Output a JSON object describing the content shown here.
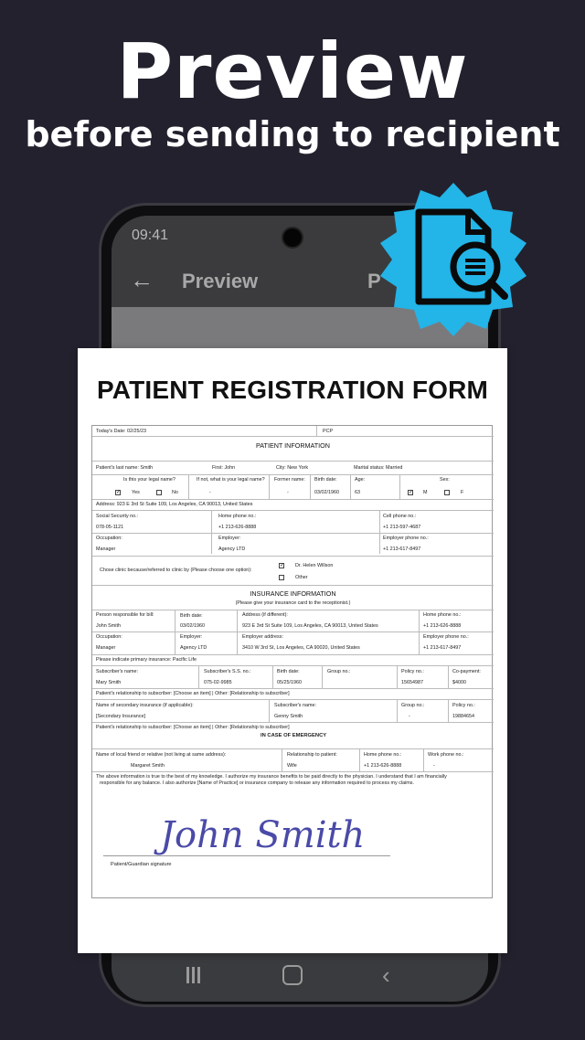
{
  "hero": {
    "title": "Preview",
    "subtitle": "before sending to recipient"
  },
  "status": {
    "time": "09:41"
  },
  "appbar": {
    "back": "←",
    "title": "Preview",
    "action": "P"
  },
  "nav": {
    "back": "‹"
  },
  "form": {
    "title": "PATIENT REGISTRATION FORM",
    "today": "Today's Date: 02/25/23",
    "pcp": "PCP",
    "patient_info": "PATIENT INFORMATION",
    "last_name": "Patient's last name: Smith",
    "first": "First: John",
    "city": "City: New York",
    "marital": "Marital status: Married",
    "legal_name_q": "Is this your legal name?",
    "legal_name_if": "If not, what is your legal name?",
    "former_name": "Former name:",
    "birth_date_lbl": "Birth date:",
    "age_lbl": "Age:",
    "sex_lbl": "Sex:",
    "yes": "Yes",
    "no": "No",
    "dash": "-",
    "birth_date": "03/02/1960",
    "age": "63",
    "m": "M",
    "f": "F",
    "address": "Address: 923 E 3rd St Suite 109, Los Angeles, CA 90013, United States",
    "ssn_lbl": "Social Security no.:",
    "ssn": "078-05-1121",
    "home_phone_lbl": "Home phone no.:",
    "home_phone": "+1 213-626-8888",
    "cell_lbl": "Cell phone no.:",
    "cell": "+1 213-597-4687",
    "occupation_lbl": "Occupation:",
    "occupation": "Manager",
    "employer_lbl": "Employer:",
    "employer": "Agency LTD",
    "emp_phone_lbl": "Employer phone no.:",
    "emp_phone": "+1 213-617-8497",
    "chose_clinic": "Chose clinic because/referred to clinic by (Please choose one option):",
    "dr": "Dr. Helen Willson",
    "other": "Other",
    "ins_info": "INSURANCE INFORMATION",
    "ins_note": "(Please give your insurance card to the receptionist.)",
    "person_bill_lbl": "Person responsible for bill:",
    "person_bill": "John Smith",
    "bd2_lbl": "Birth date:",
    "bd2": "03/02/1960",
    "addr_diff_lbl": "Address (if different):",
    "addr_diff": "923 E 3rd St Suite 109, Los Angeles, CA 90013, United States",
    "home2_lbl": "Home phone no.:",
    "home2": "+1 213-626-8888",
    "occ2_lbl": "Occupation:",
    "occ2": "Manager",
    "emp2_lbl": "Employer:",
    "emp2": "Agency LTD",
    "emp_addr_lbl": "Employer address:",
    "emp_addr": "3410 W 3rd St, Los Angeles, CA 90020, United States",
    "emp_phone2_lbl": "Employer phone no.:",
    "emp_phone2": "+1 213-617-8497",
    "primary_ins": "Please indicate primary insurance: Pacific Life",
    "sub_name_lbl": "Subscriber's name:",
    "sub_name": "Mary Smith",
    "sub_ss_lbl": "Subscriber's S.S. no.:",
    "sub_ss": "075-02-9985",
    "sub_bd_lbl": "Birth date:",
    "sub_bd": "05/25/1960",
    "group_lbl": "Group no.:",
    "policy_lbl": "Policy no.:",
    "policy": "15654987",
    "copay_lbl": "Co-payment:",
    "copay": "$4000",
    "rel1": "Patient's relationship to subscriber: [Choose an item] | Other: [Relationship to subscriber]",
    "sec_ins_lbl": "Name of secondary insurance (if applicable):",
    "sec_ins": "[Secondary Insurance]",
    "sub2_lbl": "Subscriber's name:",
    "sub2": "Genny Smith",
    "group2_lbl": "Group no.:",
    "group2": "-",
    "policy2_lbl": "Policy no.:",
    "policy2": "19884654",
    "rel2": "Patient's relationship to subscriber: [Choose an item] | Other: [Relationship to subscriber]",
    "emergency": "IN CASE OF EMERGENCY",
    "friend_lbl": "Name of local friend or relative (not living at same address):",
    "friend": "Margaret Smith",
    "rel_pat_lbl": "Relationship to patient:",
    "rel_pat": "Wife",
    "home3_lbl": "Home phone no.:",
    "home3": "+1 213-626-8888",
    "work3_lbl": "Work phone no.:",
    "work3": "-",
    "consent1": "The above information is true to the best of my knowledge. I authorize my insurance benefits to be paid directly to the physician. I understand that I am financially",
    "consent2": "responsible for any balance. I also authorize [Name of Practice] or insurance company to release any information required to process my claims.",
    "signature": "John Smith",
    "sig_label": "Patient/Guardian signature"
  }
}
